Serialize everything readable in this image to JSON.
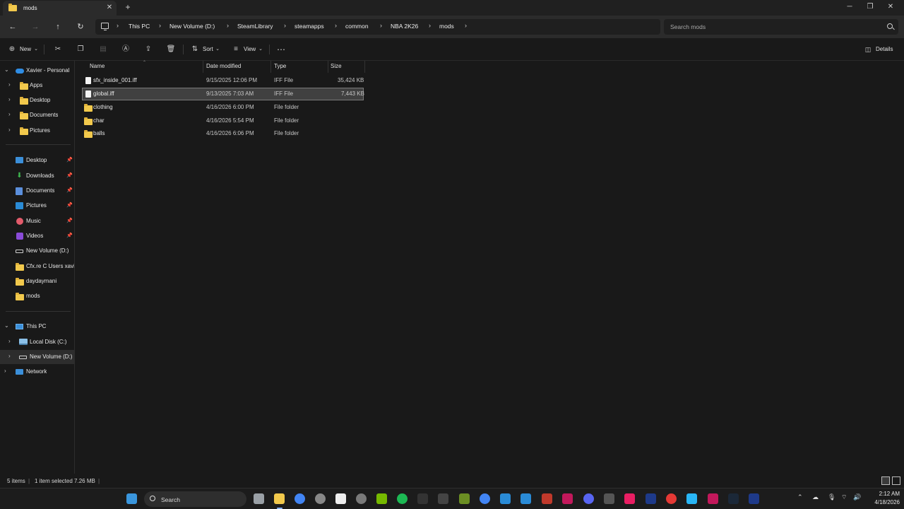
{
  "window": {
    "tab_title": "mods"
  },
  "address": {
    "crumbs": [
      "This PC",
      "New Volume (D:)",
      "SteamLibrary",
      "steamapps",
      "common",
      "NBA 2K26",
      "mods"
    ],
    "search_placeholder": "Search mods"
  },
  "toolbar": {
    "new": "New",
    "sort": "Sort",
    "view": "View",
    "details": "Details"
  },
  "sidebar": {
    "top": [
      {
        "label": "Xavier - Personal"
      },
      {
        "label": "Apps"
      },
      {
        "label": "Desktop"
      },
      {
        "label": "Documents"
      },
      {
        "label": "Pictures"
      }
    ],
    "quick": [
      {
        "label": "Desktop"
      },
      {
        "label": "Downloads"
      },
      {
        "label": "Documents"
      },
      {
        "label": "Pictures"
      },
      {
        "label": "Music"
      },
      {
        "label": "Videos"
      },
      {
        "label": "New Volume (D:)"
      },
      {
        "label": "Cfx.re  C  Users xavi"
      },
      {
        "label": "daydaymani"
      },
      {
        "label": "mods"
      }
    ],
    "pc": [
      {
        "label": "This PC"
      },
      {
        "label": "Local Disk (C:)"
      },
      {
        "label": "New Volume (D:)"
      },
      {
        "label": "Network"
      }
    ]
  },
  "columns": {
    "name": "Name",
    "date": "Date modified",
    "type": "Type",
    "size": "Size"
  },
  "files": [
    {
      "name": "sfx_inside_001.iff",
      "date": "9/15/2025 12:06 PM",
      "type": "IFF File",
      "size": "35,424 KB",
      "kind": "file"
    },
    {
      "name": "global.iff",
      "date": "9/13/2025 7:03 AM",
      "type": "IFF File",
      "size": "7,443 KB",
      "kind": "file",
      "selected": true
    },
    {
      "name": "clothing",
      "date": "4/16/2026 6:00 PM",
      "type": "File folder",
      "size": "",
      "kind": "folder"
    },
    {
      "name": "char",
      "date": "4/16/2026 5:54 PM",
      "type": "File folder",
      "size": "",
      "kind": "folder"
    },
    {
      "name": "balls",
      "date": "4/16/2026 6:06 PM",
      "type": "File folder",
      "size": "",
      "kind": "folder"
    }
  ],
  "status": {
    "items": "5 items",
    "selected": "1 item selected  7.26 MB"
  },
  "taskbar": {
    "search": "Search",
    "time": "2:12 AM",
    "date": "4/18/2026"
  },
  "colors": {
    "selected_row": "#404040",
    "folder": "#f2c94c",
    "accent": "#3b8fd9"
  }
}
